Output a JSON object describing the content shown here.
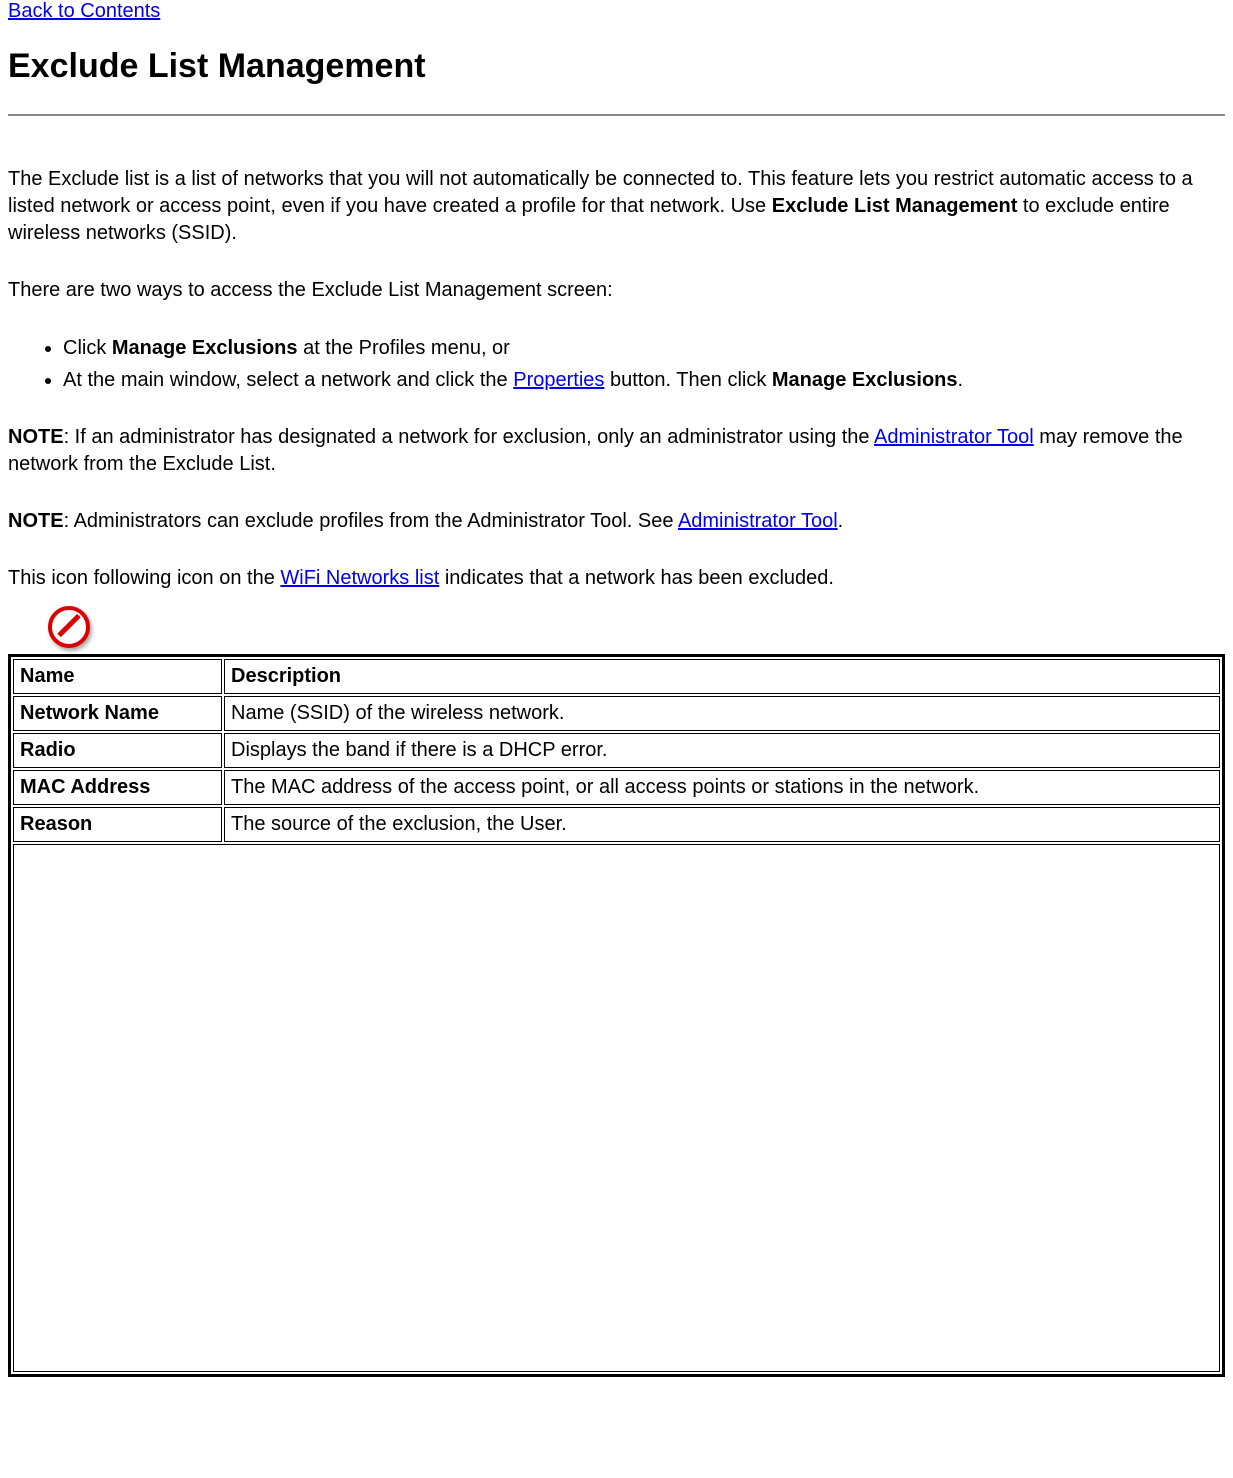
{
  "nav": {
    "back": "Back to Contents"
  },
  "title": "Exclude List Management",
  "p1": {
    "a": "The Exclude list is a list of networks that you will not automatically be connected to. This feature lets you restrict automatic access to a listed network or access point, even if you have created a profile for that network. Use ",
    "b": "Exclude List Management",
    "c": " to exclude entire wireless networks (SSID)."
  },
  "p2": "There are two ways to access the Exclude List Management screen:",
  "li1": {
    "a": "Click ",
    "b": "Manage Exclusions",
    "c": " at the Profiles menu, or"
  },
  "li2": {
    "a": "At the main window, select a network and click the ",
    "link": "Properties",
    "b": " button. Then click ",
    "bold": "Manage Exclusions",
    "c": "."
  },
  "note1": {
    "label": "NOTE",
    "a": ": If an administrator has designated a network for exclusion, only an administrator using the ",
    "link": "Administrator Tool",
    "b": " may remove the network from the Exclude List."
  },
  "note2": {
    "label": "NOTE",
    "a": ": Administrators can exclude profiles from the Administrator Tool. See ",
    "link": "Administrator Tool",
    "b": "."
  },
  "p3": {
    "a": "This icon following icon on the ",
    "link": "WiFi Networks list",
    "b": " indicates that a network has been excluded."
  },
  "table": {
    "h1": "Name",
    "h2": "Description",
    "rows": [
      {
        "name": "Network Name",
        "desc": "Name (SSID) of the wireless network."
      },
      {
        "name": "Radio",
        "desc": "Displays the band if there is a DHCP error."
      },
      {
        "name": "MAC Address",
        "desc": "The MAC address of the access point, or all access points or stations in the network."
      },
      {
        "name": "Reason",
        "desc": "The source of the exclusion, the User."
      }
    ]
  }
}
